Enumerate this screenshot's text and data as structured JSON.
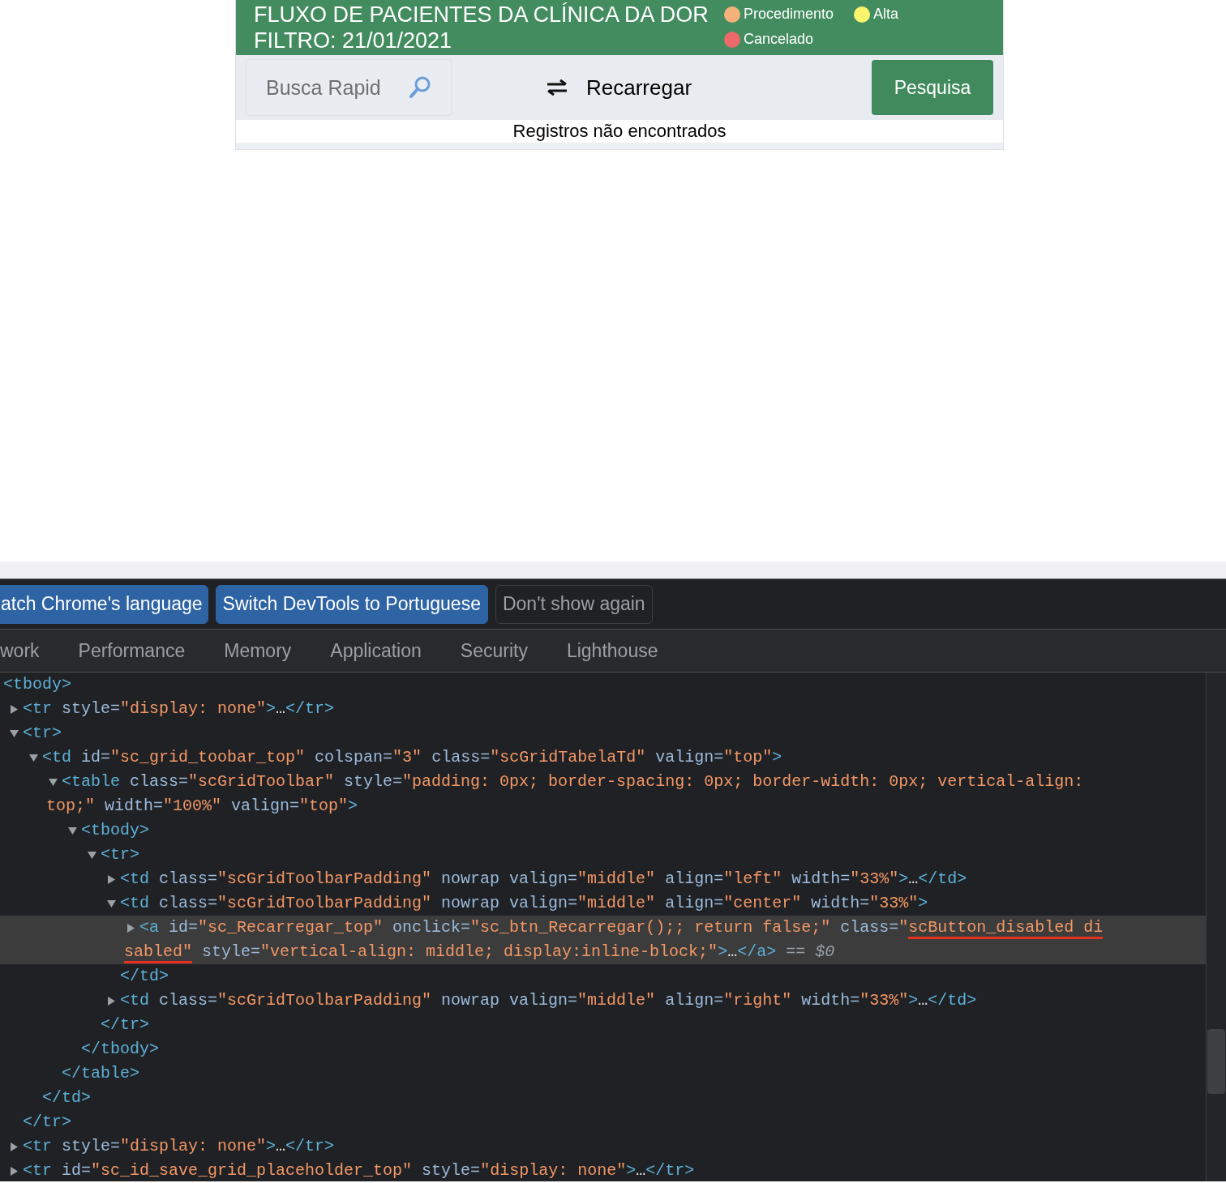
{
  "report": {
    "title": "FLUXO DE PACIENTES DA CLÍNICA DA DOR",
    "filter": "FILTRO: 21/01/2021",
    "legend": [
      {
        "label": "Procedimento",
        "color": "#f4b27a"
      },
      {
        "label": "Alta",
        "color": "#faf36c"
      },
      {
        "label": "Cancelado",
        "color": "#ec6a6a"
      }
    ],
    "search": {
      "placeholder": "Busca Rapid"
    },
    "reload_button": "Recarregar",
    "search_button": "Pesquisa",
    "message": "Registros não encontrados"
  },
  "devtools": {
    "language_banner": [
      {
        "label": "atch Chrome's language",
        "kind": "primary"
      },
      {
        "label": "Switch DevTools to Portuguese",
        "kind": "primary"
      },
      {
        "label": "Don't show again",
        "kind": "secondary"
      }
    ],
    "tabs": [
      "work",
      "Performance",
      "Memory",
      "Application",
      "Security",
      "Lighthouse"
    ],
    "elements_tree": [
      {
        "selected": false,
        "lines": [
          "<tbody>"
        ],
        "children": [
          {
            "expanded": false,
            "selected": false,
            "lines": [
              "<tr style=\"display: none\">…</tr>"
            ]
          },
          {
            "expanded": true,
            "selected": false,
            "lines": [
              "<tr>"
            ],
            "close": "</tr>",
            "children": [
              {
                "expanded": true,
                "selected": false,
                "lines": [
                  "<td id=\"sc_grid_toobar_top\" colspan=\"3\" class=\"scGridTabelaTd\" valign=\"top\">"
                ],
                "close": "</td>",
                "children": [
                  {
                    "expanded": true,
                    "selected": false,
                    "lines": [
                      "<table class=\"scGridToolbar\" style=\"padding: 0px; border-spacing: 0px; border-width: 0px; vertical-align:",
                      "top;\" width=\"100%\" valign=\"top\">"
                    ],
                    "close": "</table>",
                    "children": [
                      {
                        "expanded": true,
                        "selected": false,
                        "lines": [
                          "<tbody>"
                        ],
                        "close": "</tbody>",
                        "children": [
                          {
                            "expanded": true,
                            "selected": false,
                            "lines": [
                              "<tr>"
                            ],
                            "close": "</tr>",
                            "children": [
                              {
                                "expanded": false,
                                "selected": false,
                                "lines": [
                                  "<td class=\"scGridToolbarPadding\" nowrap valign=\"middle\" align=\"left\" width=\"33%\">…</td>"
                                ]
                              },
                              {
                                "expanded": true,
                                "selected": false,
                                "lines": [
                                  "<td class=\"scGridToolbarPadding\" nowrap valign=\"middle\" align=\"center\" width=\"33%\">"
                                ],
                                "close": "</td>",
                                "children": [
                                  {
                                    "expanded": false,
                                    "selected": true,
                                    "lines": [
                                      [
                                        "<a id=\"sc_Recarregar_top\" onclick=\"sc_btn_Recarregar();; return false;\" class=\"",
                                        {
                                          "text": "scButton_disabled di",
                                          "underlined": true
                                        }
                                      ],
                                      [
                                        {
                                          "text": "sabled\"",
                                          "underlined": true
                                        },
                                        " style=\"vertical-align: middle; display:inline-block;\">…</a>"
                                      ]
                                    ],
                                    "ref": "== $0"
                                  }
                                ]
                              },
                              {
                                "expanded": false,
                                "selected": false,
                                "lines": [
                                  "<td class=\"scGridToolbarPadding\" nowrap valign=\"middle\" align=\"right\" width=\"33%\">…</td>"
                                ]
                              }
                            ]
                          }
                        ]
                      }
                    ]
                  }
                ]
              }
            ]
          },
          {
            "expanded": false,
            "selected": false,
            "lines": [
              "<tr style=\"display: none\">…</tr>"
            ]
          },
          {
            "expanded": false,
            "selected": false,
            "lines": [
              "<tr id=\"sc_id_save_grid_placeholder_top\" style=\"display: none\">…</tr>"
            ]
          }
        ]
      }
    ]
  }
}
